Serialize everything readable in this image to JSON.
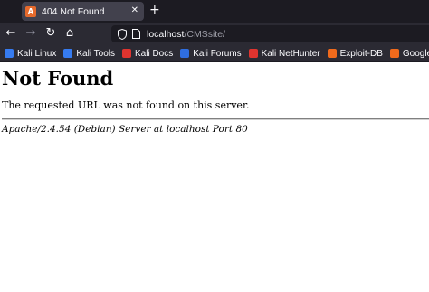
{
  "browser": {
    "tab": {
      "title": "404 Not Found",
      "favicon": "apache-feather-icon",
      "close": "✕"
    },
    "new_tab": "+",
    "nav": {
      "back": "←",
      "forward": "→",
      "reload": "↻",
      "home": "⌂"
    },
    "url": {
      "host": "localhost",
      "path": "/CMSsite/"
    },
    "bookmarks": [
      {
        "label": "Kali Linux",
        "icon": "kali-dragon-icon",
        "color": "#367bf0"
      },
      {
        "label": "Kali Tools",
        "icon": "kali-dragon-icon",
        "color": "#367bf0"
      },
      {
        "label": "Kali Docs",
        "icon": "kali-docs-icon",
        "color": "#e0342f"
      },
      {
        "label": "Kali Forums",
        "icon": "kali-forums-icon",
        "color": "#2f6ee0"
      },
      {
        "label": "Kali NetHunter",
        "icon": "kali-dragon-icon",
        "color": "#e0342f"
      },
      {
        "label": "Exploit-DB",
        "icon": "exploit-db-icon",
        "color": "#f06a1c"
      },
      {
        "label": "Google Hacking DB",
        "icon": "ghdb-icon",
        "color": "#f06a1c"
      }
    ]
  },
  "page": {
    "heading": "Not Found",
    "message": "The requested URL was not found on this server.",
    "address": "Apache/2.4.54 (Debian) Server at localhost Port 80"
  }
}
